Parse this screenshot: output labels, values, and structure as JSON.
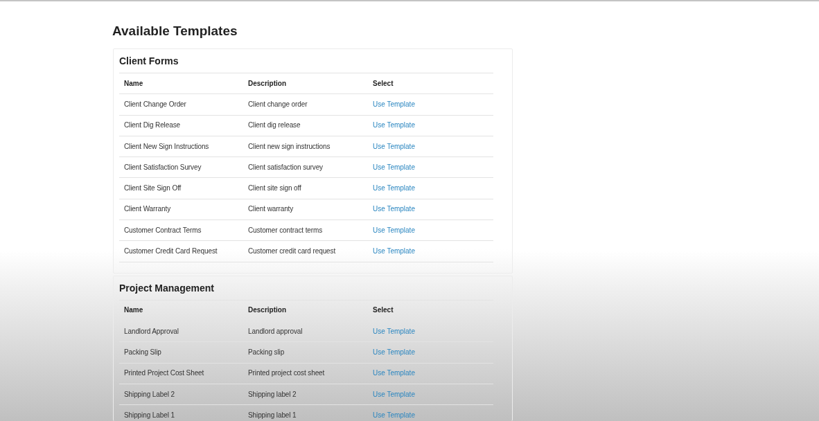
{
  "page": {
    "title": "Available Templates"
  },
  "sections": [
    {
      "title": "Client Forms",
      "columns": [
        "Name",
        "Description",
        "Select"
      ],
      "rows": [
        {
          "name": "Client Change Order",
          "description": "Client change order",
          "select": "Use Template"
        },
        {
          "name": "Client Dig Release",
          "description": "Client dig release",
          "select": "Use Template"
        },
        {
          "name": "Client New Sign Instructions",
          "description": "Client new sign instructions",
          "select": "Use Template"
        },
        {
          "name": "Client Satisfaction Survey",
          "description": "Client satisfaction survey",
          "select": "Use Template"
        },
        {
          "name": "Client Site Sign Off",
          "description": "Client site sign off",
          "select": "Use Template"
        },
        {
          "name": "Client Warranty",
          "description": "Client warranty",
          "select": "Use Template"
        },
        {
          "name": "Customer Contract Terms",
          "description": "Customer contract terms",
          "select": "Use Template"
        },
        {
          "name": "Customer Credit Card Request",
          "description": "Customer credit card request",
          "select": "Use Template"
        }
      ]
    },
    {
      "title": "Project Management",
      "columns": [
        "Name",
        "Description",
        "Select"
      ],
      "rows": [
        {
          "name": "Landlord Approval",
          "description": "Landlord approval",
          "select": "Use Template"
        },
        {
          "name": "Packing Slip",
          "description": "Packing slip",
          "select": "Use Template"
        },
        {
          "name": "Printed Project Cost Sheet",
          "description": "Printed project cost sheet",
          "select": "Use Template"
        },
        {
          "name": "Shipping Label 2",
          "description": "Shipping label 2",
          "select": "Use Template"
        },
        {
          "name": "Shipping Label 1",
          "description": "Shipping label 1",
          "select": "Use Template"
        }
      ]
    }
  ]
}
